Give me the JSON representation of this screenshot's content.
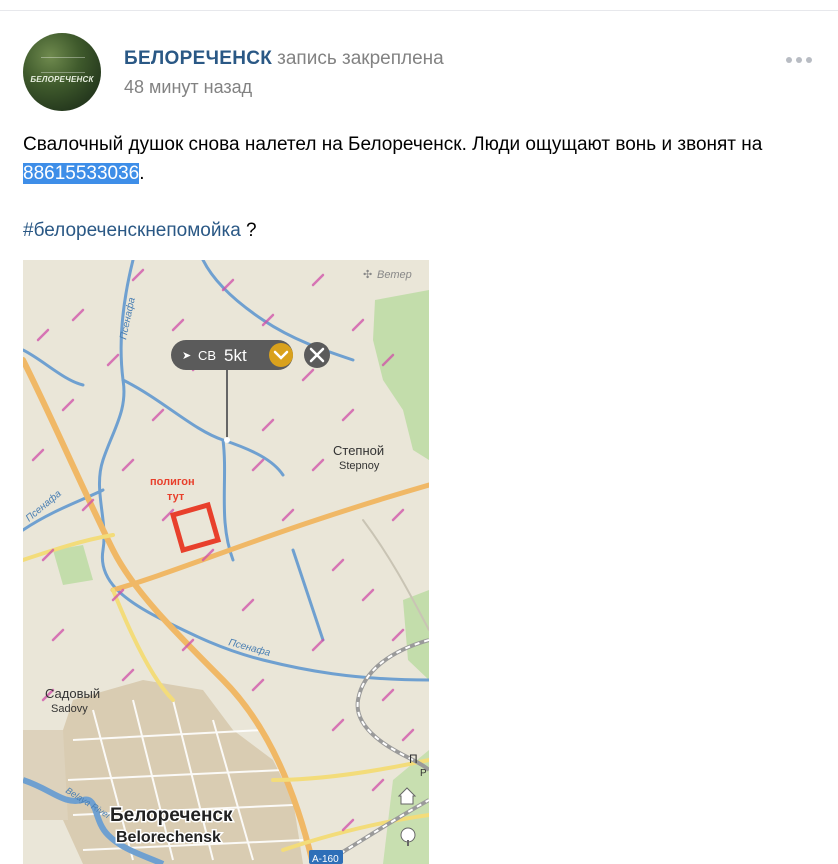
{
  "post": {
    "group_name": "БЕЛОРЕЧЕНСК",
    "pinned_label": "запись закреплена",
    "time": "48 минут назад",
    "avatar_text": "БЕЛОРЕЧЕНСК",
    "text_before": "Свалочный душок снова налетел на Белореченск. Люди ощущают вонь и звонят на ",
    "phone": "88615533036",
    "text_after": ".",
    "hashtag": "#белореченскнепомойка",
    "hashtag_suffix": " ?",
    "more_icon": "more-dots-icon"
  },
  "map": {
    "wind_layer_label": "Ветер",
    "wind_direction": "СВ",
    "wind_speed": "5kt",
    "polygon_label_line1": "полигон",
    "polygon_label_line2": "тут",
    "river_name": "Псенафа",
    "village_stepnoy_ru": "Степной",
    "village_stepnoy_en": "Stepnoy",
    "village_sadovy_ru": "Садовый",
    "village_sadovy_en": "Sadovy",
    "city_ru": "Белореченск",
    "city_en": "Belorechensk",
    "river_belaya": "Belaya River",
    "road_sign": "А-160",
    "edge_letter_1": "П",
    "edge_letter_2": "Р",
    "colors": {
      "land": "#eae6d8",
      "water": "#6fa0d0",
      "road_major": "#f0b866",
      "road_minor": "#f3dc7a",
      "urban": "#d8ccb4",
      "forest": "#b5d99a",
      "wind_streak": "#d04fa8",
      "polygon": "#e8402c"
    }
  }
}
